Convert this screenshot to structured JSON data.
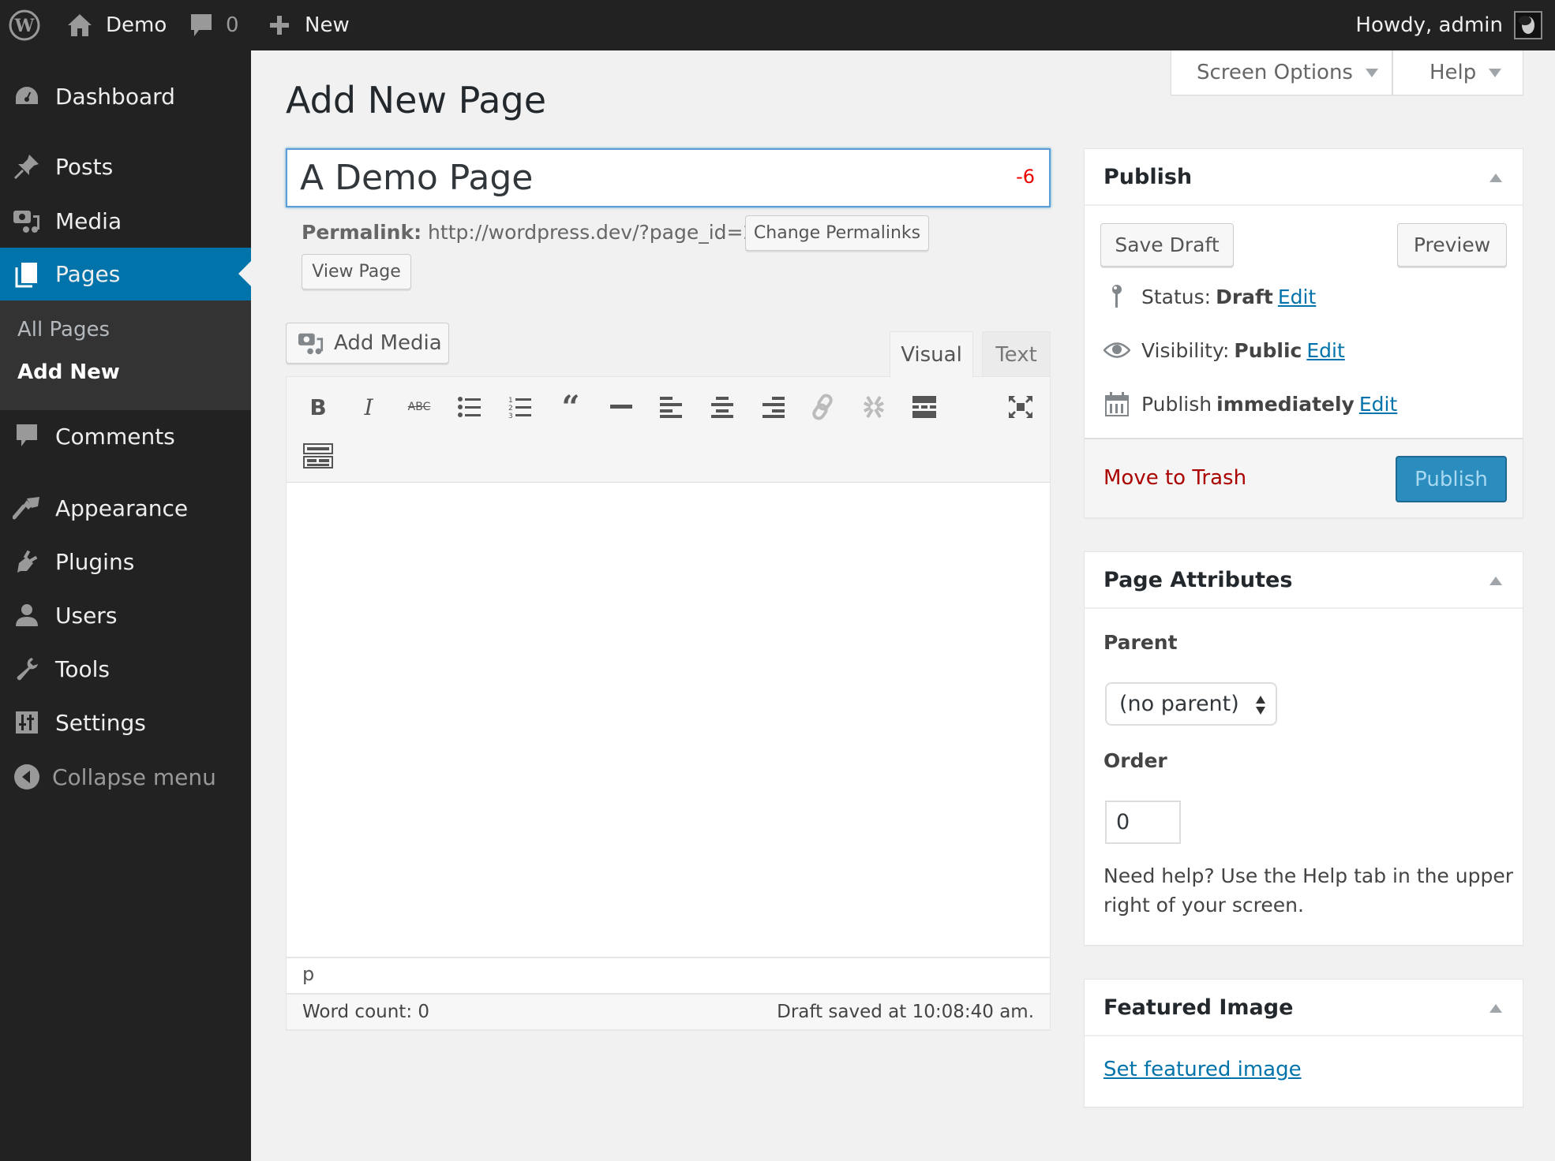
{
  "adminbar": {
    "site_name": "Demo",
    "comments_count": "0",
    "new_label": "New",
    "howdy": "Howdy, admin"
  },
  "screen_meta": {
    "screen_options": "Screen Options",
    "help": "Help"
  },
  "sidebar": {
    "items": [
      {
        "label": "Dashboard",
        "icon": "dashboard-icon"
      },
      {
        "label": "Posts",
        "icon": "pin-icon"
      },
      {
        "label": "Media",
        "icon": "media-icon"
      },
      {
        "label": "Pages",
        "icon": "pages-icon",
        "active": true
      },
      {
        "label": "Comments",
        "icon": "comment-icon"
      },
      {
        "label": "Appearance",
        "icon": "brush-icon"
      },
      {
        "label": "Plugins",
        "icon": "plug-icon"
      },
      {
        "label": "Users",
        "icon": "user-icon"
      },
      {
        "label": "Tools",
        "icon": "wrench-icon"
      },
      {
        "label": "Settings",
        "icon": "sliders-icon"
      }
    ],
    "submenu": [
      {
        "label": "All Pages"
      },
      {
        "label": "Add New",
        "current": true
      }
    ],
    "collapse_label": "Collapse menu"
  },
  "main": {
    "page_title": "Add New Page",
    "title_value": "A Demo Page",
    "title_counter": "-6",
    "permalink_label": "Permalink:",
    "permalink_url": "http://wordpress.dev/?page_id=21",
    "change_permalinks": "Change Permalinks",
    "view_page": "View Page",
    "add_media": "Add Media",
    "tabs": {
      "visual": "Visual",
      "text": "Text"
    },
    "toolbar": [
      "bold",
      "italic",
      "strikethrough",
      "bulleted-list",
      "numbered-list",
      "blockquote",
      "horizontal-line",
      "align-left",
      "align-center",
      "align-right",
      "insert-link",
      "remove-link",
      "read-more",
      "fullscreen",
      "toolbar-toggle"
    ],
    "path": "p",
    "word_count": "Word count: 0",
    "draft_saved": "Draft saved at 10:08:40 am."
  },
  "publish": {
    "title": "Publish",
    "save_draft": "Save Draft",
    "preview": "Preview",
    "status_label": "Status:",
    "status_value": "Draft",
    "visibility_label": "Visibility:",
    "visibility_value": "Public",
    "publish_label": "Publish",
    "publish_value": "immediately",
    "edit": "Edit",
    "trash": "Move to Trash",
    "publish_button": "Publish"
  },
  "page_attributes": {
    "title": "Page Attributes",
    "parent_label": "Parent",
    "parent_value": "(no parent)",
    "order_label": "Order",
    "order_value": "0",
    "help_text": "Need help? Use the Help tab in the upper right of your screen."
  },
  "featured_image": {
    "title": "Featured Image",
    "link": "Set featured image"
  },
  "colors": {
    "admin_bar": "#222222",
    "accent": "#0073aa",
    "publish_button": "#2ea2cc",
    "trash": "#a00000",
    "title_counter": "#ee0000"
  }
}
